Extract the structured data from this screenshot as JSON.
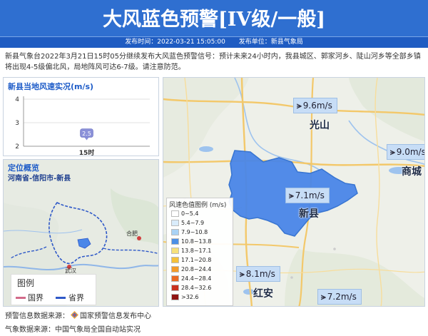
{
  "header": {
    "title": "大风蓝色预警[IV级/一般]",
    "publish_time": "发布时间：2022-03-21 15:05:00",
    "publisher": "发布单位：新县气象局"
  },
  "description": "新县气象台2022年3月21日15时05分继续发布大风蓝色预警信号：预计未来24小时内，我县城区、郭家河乡、陡山河乡等全部乡镇将出现4-5级偏北风，局地阵风可达6-7级。请注意防范。",
  "wind_panel": {
    "title": "新县当地风速实况(m/s)",
    "chart_data": {
      "type": "scatter",
      "title": "新县当地风速实况(m/s)",
      "categories": [
        "15时"
      ],
      "values": [
        2.5
      ],
      "ylim": [
        2,
        4
      ],
      "yticks": [
        "2",
        "2.5",
        "3",
        "3.5",
        "4"
      ],
      "grid": true
    }
  },
  "location_panel": {
    "title": "定位概览",
    "path": "河南省-信阳市-新县",
    "legend": {
      "title": "图例",
      "items": [
        {
          "label": "国界",
          "color": "#d26a8a"
        },
        {
          "label": "省界",
          "color": "#2f59c8"
        }
      ]
    },
    "map_labels": {
      "city1": "合肥",
      "city2": "武汉"
    }
  },
  "main_map": {
    "region_color": "#4a86e8",
    "wind_labels": [
      {
        "value": "9.6m/s"
      },
      {
        "value": "9.0m/s"
      },
      {
        "value": "7.1m/s"
      },
      {
        "value": "8.1m/s"
      },
      {
        "value": "7.2m/s"
      }
    ],
    "places": {
      "guangshan": "光山",
      "shangcheng": "商城",
      "xinxian": "新县",
      "hongan": "红安"
    },
    "scale_legend": {
      "title": "风速色值图例 (m/s)",
      "items": [
        {
          "label": "0~5.4",
          "color": "#ffffff"
        },
        {
          "label": "5.4~7.9",
          "color": "#d9ecfb"
        },
        {
          "label": "7.9~10.8",
          "color": "#a9d2f5"
        },
        {
          "label": "10.8~13.8",
          "color": "#4c8fe6"
        },
        {
          "label": "13.8~17.1",
          "color": "#f6e07a"
        },
        {
          "label": "17.1~20.8",
          "color": "#f5c13a"
        },
        {
          "label": "20.8~24.4",
          "color": "#f49b29"
        },
        {
          "label": "24.4~28.4",
          "color": "#ea6a24"
        },
        {
          "label": "28.4~32.6",
          "color": "#c9311f"
        },
        {
          "label": ">32.6",
          "color": "#8f1412"
        }
      ]
    }
  },
  "sources": {
    "warning_label": "预警信息数据来源：",
    "warning_value": "国家预警信息发布中心",
    "weather_label": "气象数据来源：",
    "weather_value": "中国气象局全国自动站实况"
  },
  "icons": {
    "wind": "wind-icon",
    "logo": "diamond-logo-icon"
  }
}
